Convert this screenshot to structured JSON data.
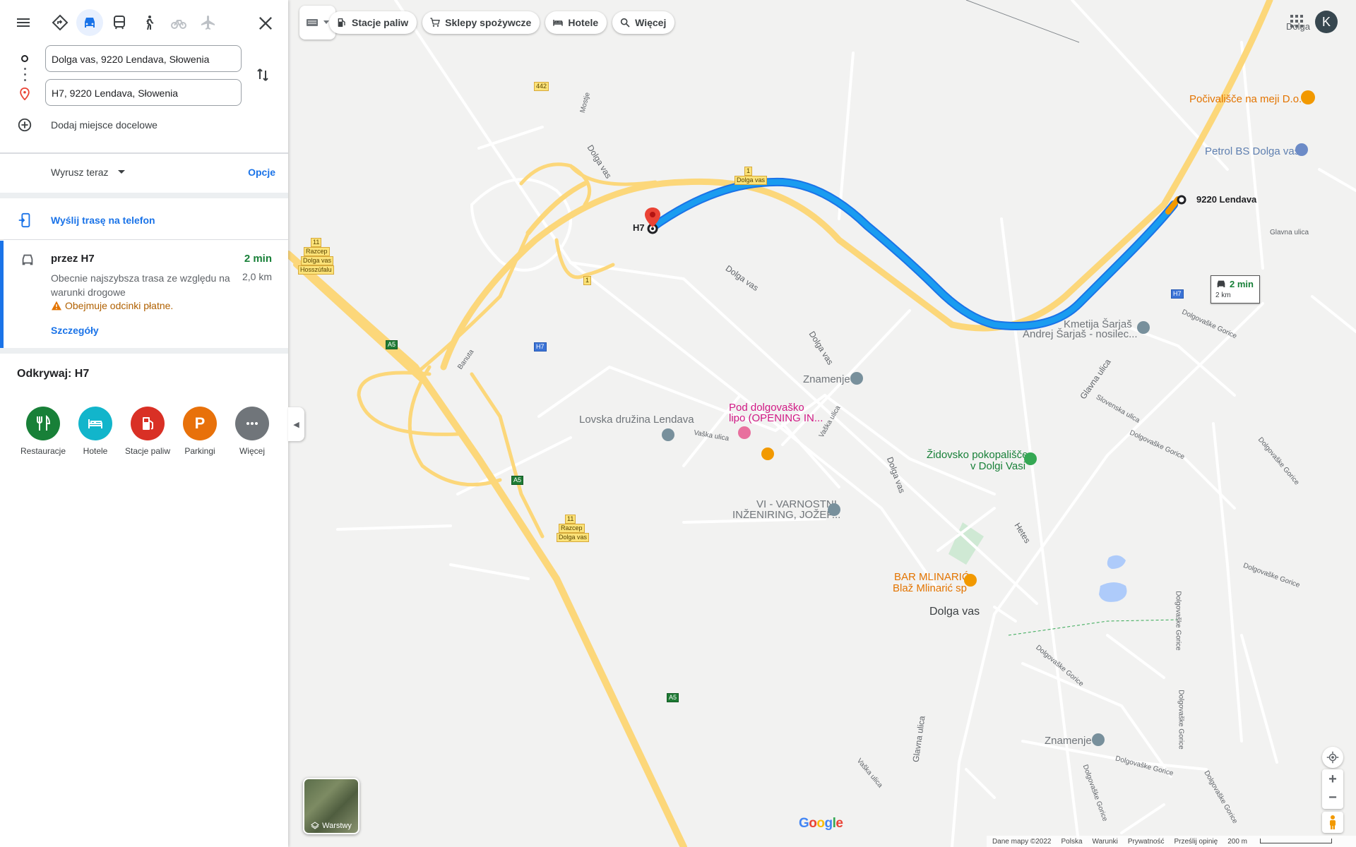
{
  "colors": {
    "accent": "#1a73e8",
    "route": "#1a9cf0",
    "fast": "#188038",
    "warning": "#b06000"
  },
  "directions": {
    "modes": [
      "best-route-icon",
      "car-icon",
      "transit-icon",
      "walk-icon",
      "bicycle-icon",
      "flight-icon"
    ],
    "active_mode": "car",
    "origin": "Dolga vas, 9220 Lendava, Słowenia",
    "destination": "H7, 9220 Lendava, Słowenia",
    "add_destination": "Dodaj miejsce docelowe",
    "depart": "Wyrusz teraz",
    "options": "Opcje",
    "send_to_phone": "Wyślij trasę na telefon"
  },
  "route": {
    "title": "przez H7",
    "time": "2 min",
    "distance": "2,0 km",
    "description": "Obecnie najszybsza trasa ze względu na warunki drogowe",
    "warning": "Obejmuje odcinki płatne.",
    "details": "Szczegóły"
  },
  "explore": {
    "title": "Odkrywaj: H7",
    "items": [
      {
        "label": "Restauracje",
        "color": "#188038",
        "icon": "fork-knife-icon"
      },
      {
        "label": "Hotele",
        "color": "#12b5cb",
        "icon": "bed-icon"
      },
      {
        "label": "Stacje paliw",
        "color": "#d93025",
        "icon": "gas-station-icon"
      },
      {
        "label": "Parkingi",
        "color": "#e8710a",
        "icon": "parking-icon"
      },
      {
        "label": "Więcej",
        "color": "#70757a",
        "icon": "more-icon"
      }
    ]
  },
  "chips": [
    {
      "label": "Stacje paliw",
      "icon": "gas-station-icon"
    },
    {
      "label": "Sklepy spożywcze",
      "icon": "cart-icon"
    },
    {
      "label": "Hotele",
      "icon": "bed-icon"
    },
    {
      "label": "Więcej",
      "icon": "search-icon"
    }
  ],
  "account_initial": "K",
  "map": {
    "route_box": {
      "time": "2 min",
      "distance": "2 km"
    },
    "labels": {
      "h7": "H7",
      "lendava": "9220 Lendava",
      "dolga_top": "Dolga",
      "pocivalisce": "Počivališče na meji D.o.o",
      "petrol": "Petrol BS Dolga vas",
      "kmetija_1": "Kmetija Šarjaš",
      "kmetija_2": "Andrej Šarjaš - nosilec...",
      "znamenje1": "Znamenje",
      "znamenje2": "Znamenje",
      "pod_1": "Pod dolgovaško",
      "pod_2": "lipo (OPENING IN...",
      "lovska": "Lovska družina Lendava",
      "zidovsko_1": "Židovsko pokopališče",
      "zidovsko_2": "v Dolgi Vasi",
      "vi_1": "VI - VARNOSTNI",
      "vi_2": "INŽENIRING, JOŽEF...",
      "bar_1": "BAR MLINARIĆ,",
      "bar_2": "Blaž Mlinarić sp",
      "dolga_vas": "Dolga vas",
      "road_dolga_vas_1": "Dolga vas",
      "road_dolga_vas_2": "Dolga vas",
      "road_dolga_vas_3": "Dolga vas",
      "road_dolga_vas_4": "Dolga vas",
      "road_glavna_1": "Glavna ulica",
      "road_glavna_2": "Glavna ulica",
      "road_glavna_3": "Glavna ulica",
      "road_hetes": "Hetes",
      "road_vaska_1": "Vaška ulica",
      "road_vaska_2": "Vaška ulica",
      "road_vaska_3": "Vaška ulica",
      "road_banuta": "Banuta",
      "road_mostje": "Mostje",
      "road_slovenska": "Slovenska ulica",
      "road_dg1": "Dolgovaške Gorice",
      "road_dg2": "Dolgovaške Gorice",
      "road_dg3": "Dolgovaške Gorice",
      "road_dg4": "Dolgovaške Gorice",
      "road_dg5": "Dolgovaške Gorice",
      "road_dg6": "Dolgovaške Gorice",
      "road_dg7": "Dolgovaške Gorice",
      "road_dg8": "Dolgovaške Gorice",
      "road_dg9": "Dolgovaške Gorice",
      "road_dg10": "Dolgovaške Gorice"
    },
    "shields": {
      "s442": "442",
      "s1a": "1",
      "s1a_name": "Dolga vas",
      "s1b": "1",
      "s11a": "11",
      "s11a_1": "Razcep",
      "s11a_2": "Dolga vas",
      "s11a_3": "Hosszúfalu",
      "s11b": "11",
      "s11b_1": "Razcep",
      "s11b_2": "Dolga vas",
      "s_h7a": "H7",
      "s_h7b": "H7",
      "s_a5a": "A5",
      "s_a5b": "A5",
      "s_a5c": "A5"
    }
  },
  "layers_label": "Warstwy",
  "google": [
    "G",
    "o",
    "o",
    "g",
    "l",
    "e"
  ],
  "footer": {
    "data": "Dane mapy ©2022",
    "country": "Polska",
    "terms": "Warunki",
    "privacy": "Prywatność",
    "feedback": "Prześlij opinię",
    "scale": "200 m"
  }
}
